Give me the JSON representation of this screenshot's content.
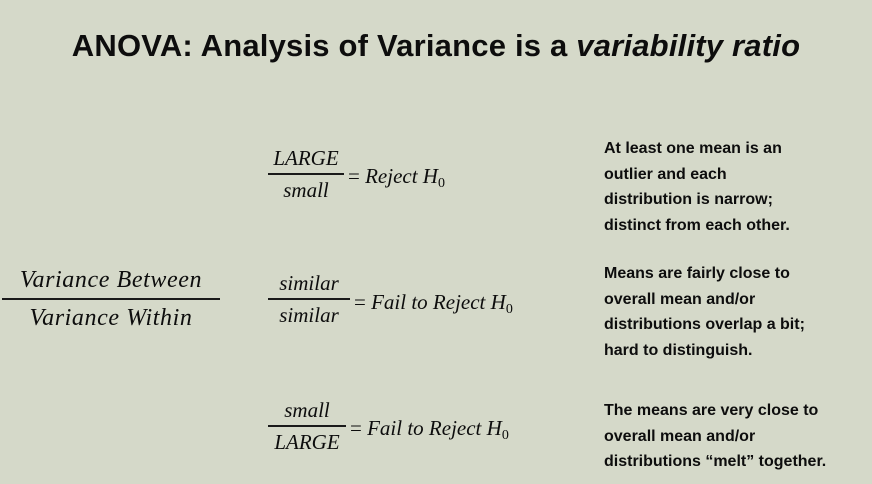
{
  "title": {
    "prefix": "ANOVA: Analysis of Variance is a ",
    "emphasis": "variability ratio"
  },
  "main_fraction": {
    "numerator": "Variance Between",
    "denominator": "Variance Within"
  },
  "rules": [
    {
      "numerator": "LARGE",
      "denominator": "small",
      "result_prefix": "= ",
      "result_text": "Reject H",
      "result_sub": "0",
      "description_lines": [
        "At least one mean is an",
        "outlier and each",
        "distribution is narrow;",
        "distinct from each other."
      ]
    },
    {
      "numerator": "similar",
      "denominator": "similar",
      "result_prefix": "= ",
      "result_text": "Fail to Reject H",
      "result_sub": "0",
      "description_lines": [
        "Means are fairly close to",
        "overall mean and/or",
        "distributions overlap a bit;",
        "hard to distinguish."
      ]
    },
    {
      "numerator": "small",
      "denominator": "LARGE",
      "result_prefix": "= ",
      "result_text": "Fail to Reject H",
      "result_sub": "0",
      "description_lines": [
        "The means are very close to",
        "overall mean and/or",
        "distributions “melt” together."
      ]
    }
  ]
}
